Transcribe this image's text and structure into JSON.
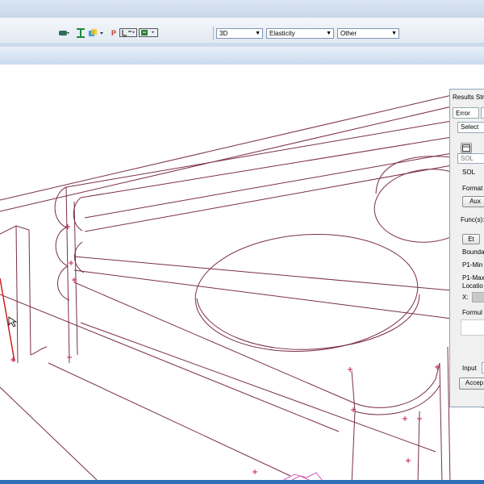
{
  "app": {
    "title": ""
  },
  "toolbar": {
    "icons": [
      "layer-icon",
      "beam-icon",
      "grid-icon",
      "pin-icon",
      "frame-icon",
      "node-icon"
    ],
    "pin_label": "P",
    "view_combo": "3D",
    "analysis_combo": "Elasticity",
    "other_combo": "Other"
  },
  "panel": {
    "title": "Results Stre",
    "tab_error": "Error",
    "tab_second": "",
    "select_label": "Select",
    "sol_input": "SOL",
    "sol_label": "SOL",
    "format_label": "Format",
    "aux_button": "Aux",
    "funcs_label": "Func(s):",
    "et_button": "Et",
    "bounda_label": "Bounda",
    "p1min_label": "P1-Min",
    "p1max_label": "P1-Max",
    "location_label": "Locatio",
    "x_label": "X:",
    "formula_label": "Formul",
    "input_label": "Input",
    "accept_button": "Accep"
  },
  "colors": {
    "wire": "#7a2f45",
    "edge_red": "#cc2222",
    "node_marker": "#c2185b",
    "taskbar": "#2d6fb6"
  }
}
